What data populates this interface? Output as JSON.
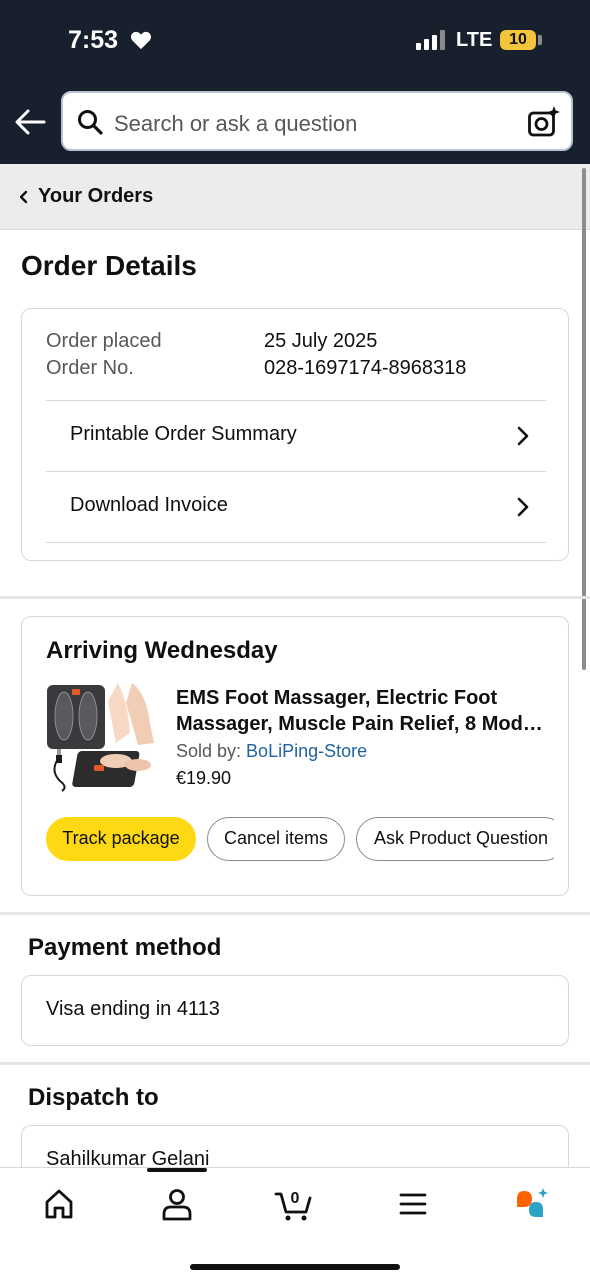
{
  "status_bar": {
    "time": "7:53",
    "network": "LTE",
    "battery": "10"
  },
  "header": {
    "search_placeholder": "Search or ask a question"
  },
  "breadcrumb": {
    "label": "Your Orders"
  },
  "page": {
    "title": "Order Details"
  },
  "order_info": {
    "placed_label": "Order placed",
    "placed_value": "25 July 2025",
    "number_label": "Order No.",
    "number_value": "028-1697174-8968318",
    "links": [
      {
        "label": "Printable Order Summary"
      },
      {
        "label": "Download Invoice"
      }
    ]
  },
  "shipment": {
    "arrival": "Arriving Wednesday",
    "product_title_line1": "EMS Foot Massager, Electric Foot",
    "product_title_line2": "Massager, Muscle Pain Relief, 8 Mod…",
    "sold_by_label": "Sold by: ",
    "sold_by_store": "BoLiPing-Store",
    "price": "€19.90",
    "buttons": [
      {
        "label": "Track package"
      },
      {
        "label": "Cancel items"
      },
      {
        "label": "Ask Product Question"
      }
    ]
  },
  "payment": {
    "title": "Payment method",
    "value": "Visa  ending in 4113"
  },
  "dispatch": {
    "title": "Dispatch to",
    "name": "Sahilkumar Gelani"
  },
  "bottom_nav": {
    "cart_count": "0"
  },
  "colors": {
    "header_bg": "#17202c",
    "primary_button": "#ffd814",
    "link": "#2162a1"
  }
}
